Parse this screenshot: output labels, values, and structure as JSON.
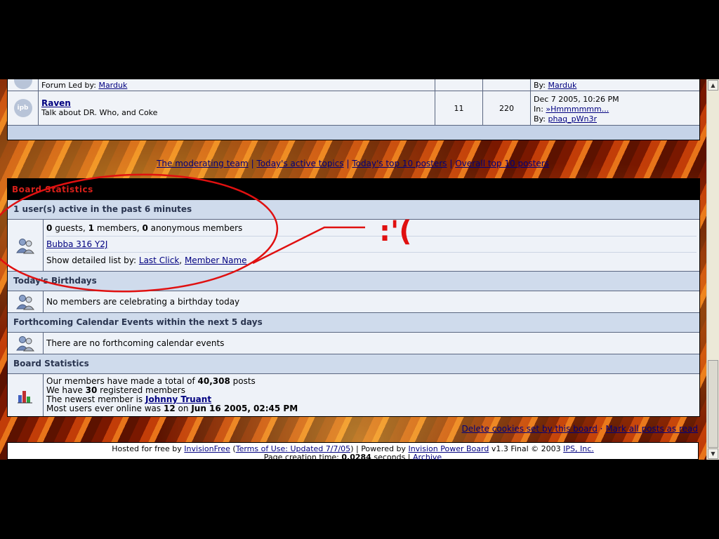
{
  "forums": [
    {
      "led_label": "Forum Led by:",
      "led_by": "Marduk",
      "last_by_label": "By:",
      "last_by": "Marduk"
    },
    {
      "title": "Raven",
      "description": "Talk about DR. Who, and Coke",
      "topics": "11",
      "replies": "220",
      "last_date": "Dec 7 2005, 10:26 PM",
      "last_in_label": "In:",
      "last_in": "»Hmmmmmm...",
      "last_by_label": "By:",
      "last_by": "phaq_pWn3r",
      "icon_text": "ipb"
    }
  ],
  "links": {
    "moderating_team": "The moderating team",
    "active_topics": "Today's active topics",
    "top10_today": "Today's top 10 posters",
    "top10_overall": "Overall top 10 posters",
    "sep": "|"
  },
  "stats": {
    "header": "Board Statistics",
    "active": {
      "title": "1 user(s) active in the past 6 minutes",
      "guests_num": "0",
      "guests_label": "guests,",
      "members_num": "1",
      "members_label": "members,",
      "anon_num": "0",
      "anon_label": "anonymous members",
      "user": "Bubba 316 Y2J",
      "detail_label": "Show detailed list by:",
      "last_click": "Last Click",
      "comma": ",",
      "member_name": "Member Name"
    },
    "birthdays": {
      "title": "Today's Birthdays",
      "text": "No members are celebrating a birthday today"
    },
    "calendar": {
      "title": "Forthcoming Calendar Events within the next 5 days",
      "text": "There are no forthcoming calendar events"
    },
    "board": {
      "title": "Board Statistics",
      "posts_pre": "Our members have made a total of",
      "posts_num": "40,308",
      "posts_post": "posts",
      "reg_pre": "We have",
      "reg_num": "30",
      "reg_post": "registered members",
      "newest_pre": "The newest member is",
      "newest": "Johnny Truant",
      "most_pre": "Most users ever online was",
      "most_num": "12",
      "most_on": "on",
      "most_date": "Jun 16 2005, 02:45 PM"
    }
  },
  "footer": {
    "delete_cookies": "Delete cookies set by this board",
    "dot": "·",
    "mark_read": "Mark all posts as read",
    "hosted_pre": "Hosted for free by",
    "invisionfree": "InvisionFree",
    "terms": "Terms of Use: Updated 7/7/05",
    "powered": "Powered by",
    "ipb": "Invision Power Board",
    "version": "v1.3 Final © 2003",
    "ips": "IPS, Inc.",
    "page_time_pre": "Page creation time:",
    "page_time": "0.0284",
    "page_time_post": "seconds",
    "archive": "Archive"
  },
  "annotation": {
    "emoticon": ":'(",
    "color": "#e01010"
  },
  "colors": {
    "link": "#000080",
    "stats_header_bg": "#000000",
    "stats_header_text": "#d8201a",
    "subheader_bg": "#cfdbec"
  }
}
